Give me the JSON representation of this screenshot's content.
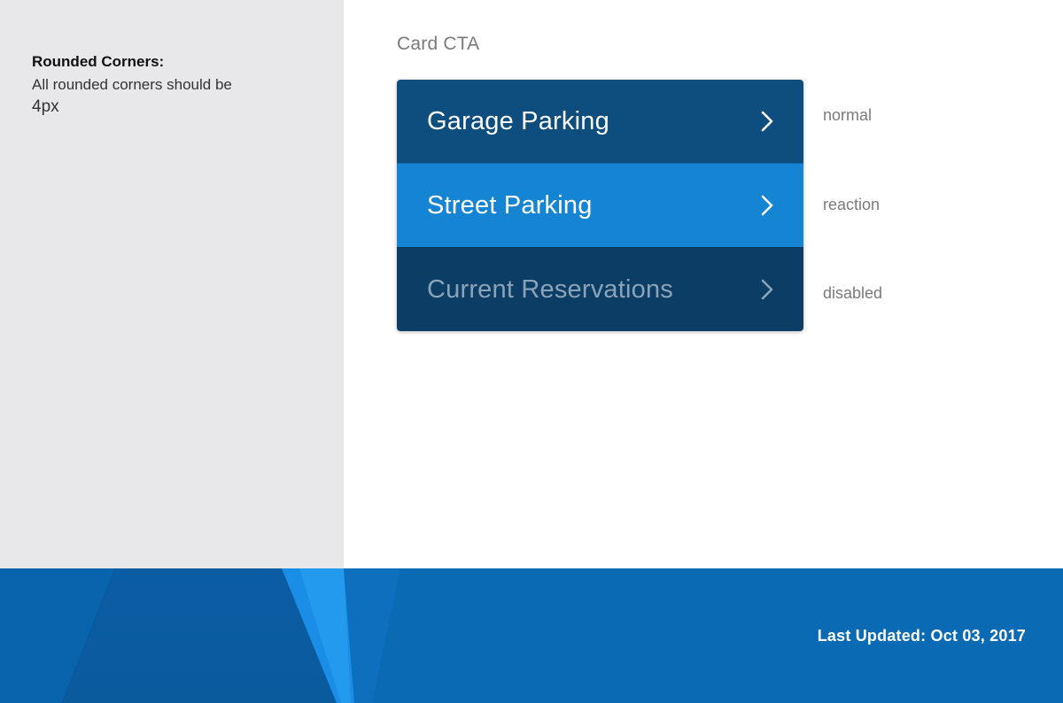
{
  "note": {
    "title": "Rounded Corners:",
    "text": "All rounded corners should be",
    "value": "4px"
  },
  "section": {
    "title": "Card CTA"
  },
  "card": {
    "items": [
      {
        "label": "Garage Parking",
        "state": "normal",
        "icon": "chevron-right-icon"
      },
      {
        "label": "Street Parking",
        "state": "reaction",
        "icon": "chevron-right-icon"
      },
      {
        "label": "Current Reservations",
        "state": "disabled",
        "icon": "chevron-right-icon"
      }
    ]
  },
  "colors": {
    "normal": "#0d4e7e",
    "reaction": "#1584d2",
    "disabled": "#0b3d65",
    "footer": "#0a6ab4",
    "sidebar": "#e8e8ea"
  },
  "footer": {
    "text": "Last Updated: Oct 03, 2017"
  }
}
